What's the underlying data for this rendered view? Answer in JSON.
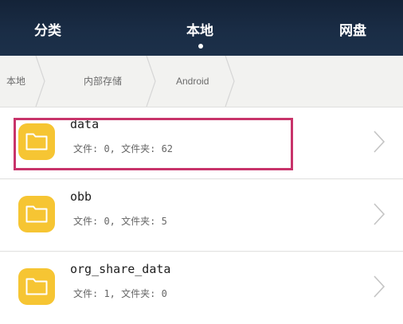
{
  "tabs": [
    {
      "label": "分类"
    },
    {
      "label": "本地"
    },
    {
      "label": "网盘"
    }
  ],
  "active_tab": "本地",
  "breadcrumb": [
    {
      "label": "本地"
    },
    {
      "label": "内部存储"
    },
    {
      "label": "Android"
    }
  ],
  "folders": [
    {
      "name": "data",
      "meta": "文件: 0, 文件夹: 62",
      "icon": "folder-icon",
      "highlighted": true
    },
    {
      "name": "obb",
      "meta": "文件: 0, 文件夹: 5",
      "icon": "folder-icon"
    },
    {
      "name": "org_share_data",
      "meta": "文件: 1, 文件夹: 0",
      "icon": "folder-icon"
    }
  ],
  "colors": {
    "topbar": "#1a2d46",
    "folder": "#f6c533",
    "highlight": "#c8336a"
  }
}
